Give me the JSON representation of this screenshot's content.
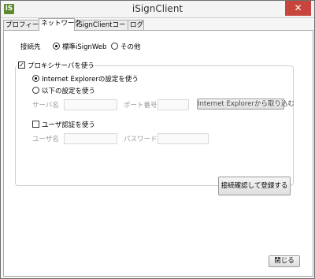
{
  "window": {
    "title": "iSignClient",
    "icon_text": "iS",
    "close_glyph": "✕"
  },
  "tabs": [
    {
      "label": "プロフィール",
      "active": false
    },
    {
      "label": "ネットワーク",
      "active": true
    },
    {
      "label": "iSignClientコード",
      "active": false
    },
    {
      "label": "ログ",
      "active": false
    }
  ],
  "network": {
    "destination_label": "接続先",
    "destination_options": [
      {
        "label": "標準iSignWeb",
        "selected": true
      },
      {
        "label": "その他",
        "selected": false
      }
    ],
    "use_proxy": {
      "label": "プロキシサーバを使う",
      "checked": true
    },
    "proxy_modes": [
      {
        "label": "Internet Explorerの設定を使う",
        "selected": true
      },
      {
        "label": "以下の設定を使う",
        "selected": false
      }
    ],
    "server_name_label": "サーバ名",
    "server_name_value": "",
    "port_label": "ポート番号",
    "port_value": "",
    "import_ie_button": "Internet Explorerから取り込む",
    "user_auth": {
      "label": "ユーザ認証を使う",
      "checked": false
    },
    "username_label": "ユーザ名",
    "username_value": "",
    "password_label": "パスワード",
    "password_value": "",
    "register_button": "接続確認して登録する",
    "close_button": "閉じる"
  }
}
